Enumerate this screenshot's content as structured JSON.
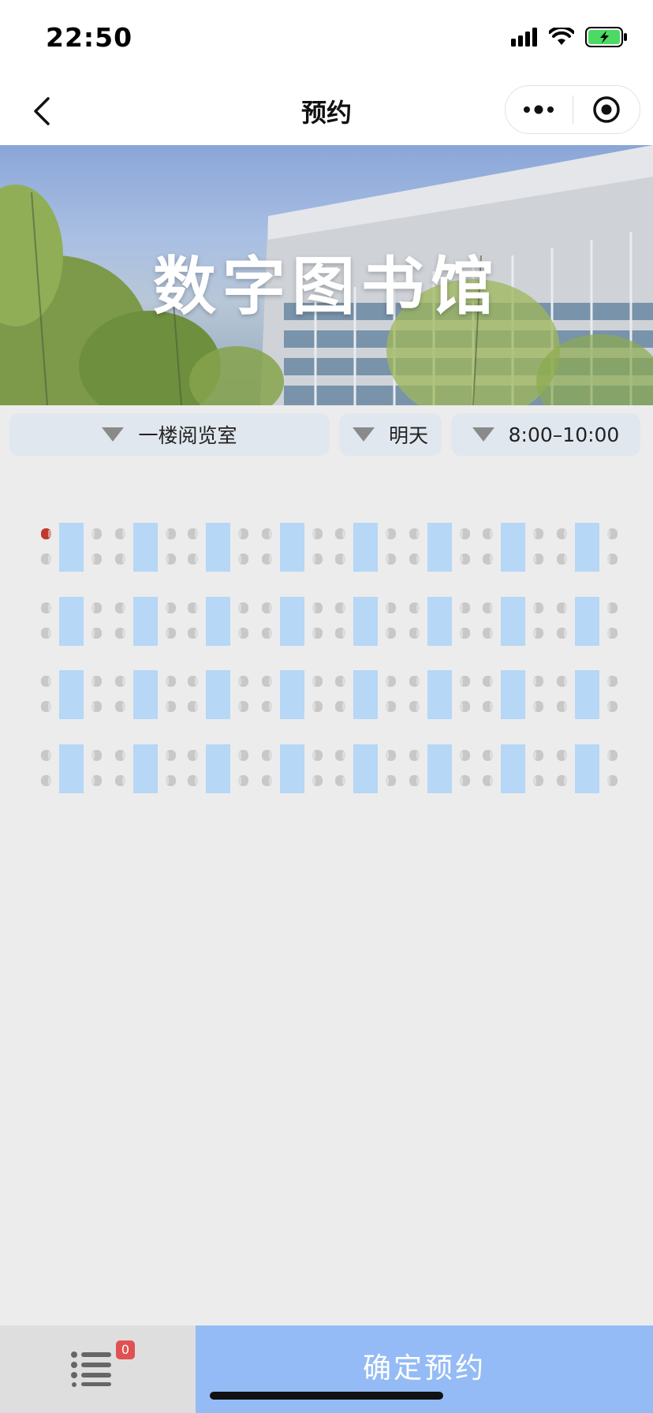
{
  "status_bar": {
    "time": "22:50"
  },
  "nav": {
    "title": "预约"
  },
  "banner": {
    "title": "数字图书馆"
  },
  "filters": {
    "room": "一楼阅览室",
    "day": "明天",
    "time_slot": "8:00–10:00"
  },
  "seat_map": {
    "rows": 4,
    "tables_per_row": 8,
    "seats_per_table": 4,
    "selected_seat": {
      "row": 1,
      "table": 1,
      "position": "left-top"
    },
    "colors": {
      "table": "#b6d7f6",
      "seat": "#c8c8c8",
      "selected_seat": "#c0392b"
    }
  },
  "bottom_bar": {
    "cart_count": "0",
    "confirm_label": "确定预约"
  },
  "colors": {
    "page_bg": "#ececec",
    "filter_bg": "#e1e7ef",
    "confirm_bg": "#94bbf5",
    "badge_bg": "#e05252"
  }
}
